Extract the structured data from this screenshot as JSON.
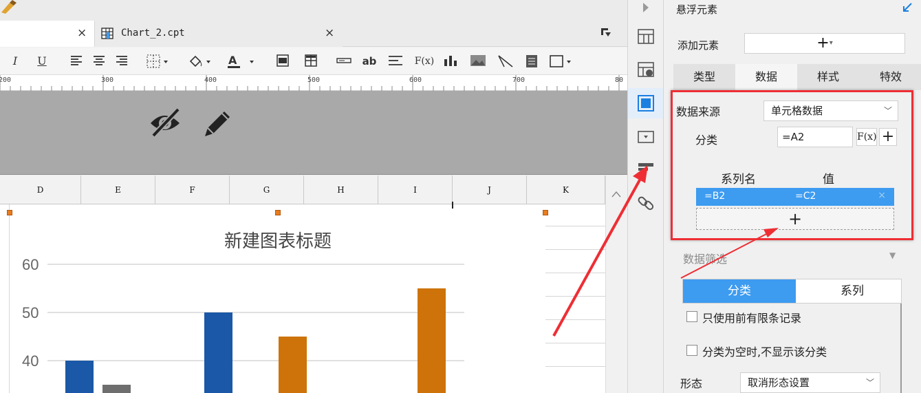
{
  "tabs": {
    "chart_tab_label": "Chart_2.cpt",
    "close_symbol": "×"
  },
  "toolbar": {
    "italic": "I",
    "underline": "U",
    "text_ab": "ab",
    "formula": "F(x)"
  },
  "ruler": {
    "labels": [
      "200",
      "300",
      "400",
      "500",
      "600",
      "700",
      "80"
    ]
  },
  "sheet": {
    "columns": [
      "D",
      "E",
      "F",
      "G",
      "H",
      "I",
      "J",
      "K"
    ]
  },
  "chart_data": {
    "type": "bar",
    "title": "新建图表标题",
    "yaxis_ticks": [
      60,
      50,
      40
    ],
    "ylim": [
      30,
      60
    ],
    "series": [
      {
        "color": "#1b58a7",
        "values": [
          40,
          50
        ]
      },
      {
        "color": "#6e6e6e",
        "values": [
          35
        ]
      },
      {
        "color": "#cd7309",
        "values": [
          45,
          55
        ]
      }
    ]
  },
  "icons": {
    "colors": {
      "accent_blue": "#3d9bf0",
      "highlight_red": "#ee2e34"
    }
  },
  "panel": {
    "title": "悬浮元素",
    "add_element_label": "添加元素",
    "add_symbol": "+",
    "tabs": [
      "类型",
      "数据",
      "样式",
      "特效"
    ],
    "active_tab": "数据",
    "data_source_label": "数据来源",
    "data_source_value": "单元格数据",
    "category_label": "分类",
    "category_value": "=A2",
    "fx_label": "F(x)",
    "plus_label": "+",
    "series_name_header": "系列名",
    "value_header": "值",
    "series_name_value": "=B2",
    "series_value_value": "=C2",
    "series_delete": "×",
    "add_row_symbol": "+",
    "filter_title": "数据筛选",
    "filter_tab_category": "分类",
    "filter_tab_series": "系列",
    "checkbox_1": "只使用前有限条记录",
    "checkbox_2": "分类为空时,不显示该分类",
    "shape_label": "形态",
    "shape_value": "取消形态设置",
    "chevron": "﹀"
  }
}
